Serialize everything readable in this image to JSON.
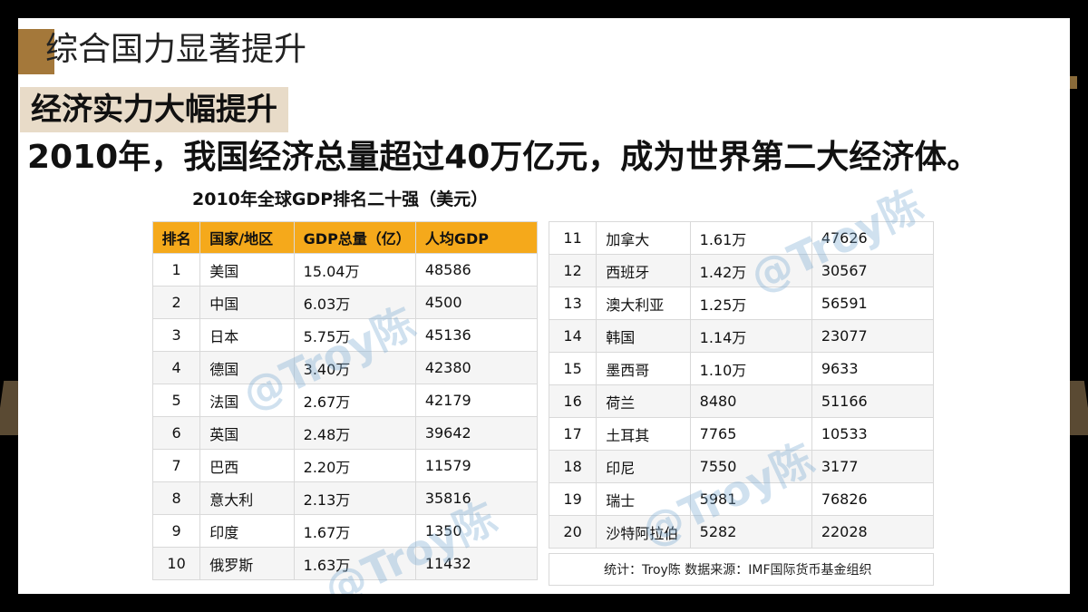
{
  "slide": {
    "title": "综合国力显著提升",
    "subtitle": "经济实力大幅提升",
    "headline": "2010年，我国经济总量超过40万亿元，成为世界第二大经济体。",
    "caption": "2010年全球GDP排名二十强（美元）",
    "headers": [
      "排名",
      "国家/地区",
      "GDP总量（亿）",
      "人均GDP"
    ],
    "rows_left": [
      {
        "rank": "1",
        "country": "美国",
        "gdp": "15.04万",
        "per_capita": "48586"
      },
      {
        "rank": "2",
        "country": "中国",
        "gdp": "6.03万",
        "per_capita": "4500"
      },
      {
        "rank": "3",
        "country": "日本",
        "gdp": "5.75万",
        "per_capita": "45136"
      },
      {
        "rank": "4",
        "country": "德国",
        "gdp": "3.40万",
        "per_capita": "42380"
      },
      {
        "rank": "5",
        "country": "法国",
        "gdp": "2.67万",
        "per_capita": "42179"
      },
      {
        "rank": "6",
        "country": "英国",
        "gdp": "2.48万",
        "per_capita": "39642"
      },
      {
        "rank": "7",
        "country": "巴西",
        "gdp": "2.20万",
        "per_capita": "11579"
      },
      {
        "rank": "8",
        "country": "意大利",
        "gdp": "2.13万",
        "per_capita": "35816"
      },
      {
        "rank": "9",
        "country": "印度",
        "gdp": "1.67万",
        "per_capita": "1350"
      },
      {
        "rank": "10",
        "country": "俄罗斯",
        "gdp": "1.63万",
        "per_capita": "11432"
      }
    ],
    "rows_right": [
      {
        "rank": "11",
        "country": "加拿大",
        "gdp": "1.61万",
        "per_capita": "47626"
      },
      {
        "rank": "12",
        "country": "西班牙",
        "gdp": "1.42万",
        "per_capita": "30567"
      },
      {
        "rank": "13",
        "country": "澳大利亚",
        "gdp": "1.25万",
        "per_capita": "56591"
      },
      {
        "rank": "14",
        "country": "韩国",
        "gdp": "1.14万",
        "per_capita": "23077"
      },
      {
        "rank": "15",
        "country": "墨西哥",
        "gdp": "1.10万",
        "per_capita": "9633"
      },
      {
        "rank": "16",
        "country": "荷兰",
        "gdp": "8480",
        "per_capita": "51166"
      },
      {
        "rank": "17",
        "country": "土耳其",
        "gdp": "7765",
        "per_capita": "10533"
      },
      {
        "rank": "18",
        "country": "印尼",
        "gdp": "7550",
        "per_capita": "3177"
      },
      {
        "rank": "19",
        "country": "瑞士",
        "gdp": "5981",
        "per_capita": "76826"
      },
      {
        "rank": "20",
        "country": "沙特阿拉伯",
        "gdp": "5282",
        "per_capita": "22028"
      }
    ],
    "footnote": "统计：Troy陈 数据来源：IMF国际货币基金组织",
    "watermark": "@Troy陈"
  },
  "colors": {
    "accent": "#a4783a",
    "header_bg": "#f5a91b",
    "subtitle_bg": "#e8dbc8"
  }
}
